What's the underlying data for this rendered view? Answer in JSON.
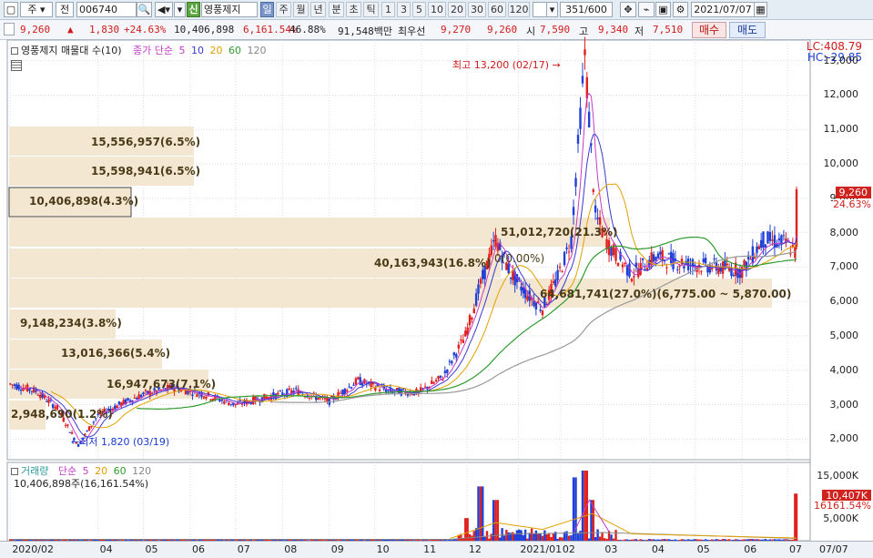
{
  "toolbar": {
    "market": "주",
    "period_mode": "전",
    "code": "006740",
    "name_badge": "신",
    "stock_name": "영풍제지",
    "interval_active": "일",
    "intervals": [
      "주",
      "월",
      "년",
      "분",
      "초",
      "틱"
    ],
    "minutes": [
      "1",
      "3",
      "5",
      "10",
      "20",
      "30",
      "60",
      "120"
    ],
    "count": "351/600",
    "date": "2021/07/07"
  },
  "pricebar": {
    "price": "9,260",
    "change": "1,830",
    "change_rate": "+24.63%",
    "volume": "10,406,898",
    "volume_rate": "6,161.54%",
    "ratio": "46.88%",
    "amount": "91,548백만",
    "best_label": "최우선",
    "ask": "9,270",
    "bid": "9,260",
    "open_label": "시",
    "open": "7,590",
    "high_label": "고",
    "high": "9,340",
    "low_label": "저",
    "low": "7,510",
    "buy_label": "매수",
    "sell_label": "매도"
  },
  "price_panel": {
    "legend_title": "영풍제지 매물대 수(10)",
    "ma_label": "종가 단순",
    "ma_periods": [
      "5",
      "10",
      "20",
      "60",
      "120"
    ],
    "ma_colors": [
      "#c43cc7",
      "#3a3ad0",
      "#e0a000",
      "#2e9b2e",
      "#888888"
    ],
    "lc": "LC:408.79",
    "hc": "HC:-29.85",
    "y_ticks": [
      "13,000",
      "12,000",
      "11,000",
      "10,000",
      "9,000",
      "8,000",
      "7,000",
      "6,000",
      "5,000",
      "4,000",
      "3,000",
      "2,000"
    ],
    "current_tag": "9,260",
    "current_rate": "24.63%",
    "high_annotation": "최고 13,200 (02/17)",
    "low_annotation": "최저 1,820 (03/19)"
  },
  "volume_profile": [
    {
      "text": "15,556,957(6.5%)"
    },
    {
      "text": "15,598,941(6.5%)"
    },
    {
      "text": "10,406,898(4.3%)"
    },
    {
      "text": "51,012,720(21.3%)"
    },
    {
      "text": "40,163,943(16.8%)"
    },
    {
      "text": "0(0.00%)"
    },
    {
      "text": "64,681,741(27.0%)(6,775.00 ~ 5,870.00)"
    },
    {
      "text": "9,148,234(3.8%)"
    },
    {
      "text": "13,016,366(5.4%)"
    },
    {
      "text": "16,947,673(7.1%)"
    },
    {
      "text": "2,948,690(1.2%)"
    }
  ],
  "volume_panel": {
    "legend_title": "거래량",
    "ma_label": "단순",
    "ma_periods": [
      "5",
      "20",
      "60",
      "120"
    ],
    "ma_colors": [
      "#c43cc7",
      "#e0a000",
      "#2e9b2e",
      "#888888"
    ],
    "last_volume": "10,406,898주(16,161.54%)",
    "y_ticks": [
      "15,000K",
      "5,000K"
    ],
    "current_tag": "10,407K",
    "current_rate": "16161.54%"
  },
  "x_axis": {
    "labels": [
      "2020/02",
      "04",
      "05",
      "06",
      "07",
      "08",
      "09",
      "10",
      "11",
      "12",
      "2021/01",
      "02",
      "03",
      "04",
      "05",
      "06",
      "07"
    ],
    "right_label": "07/07"
  },
  "chart_data": {
    "type": "candlestick",
    "title": "영풍제지 매물대 수(10)",
    "y_unit": "KRW",
    "ylim": [
      1400,
      13600
    ],
    "price_path": [
      [
        "2020-02-03",
        3600
      ],
      [
        "2020-02-20",
        3400
      ],
      [
        "2020-03-05",
        2900
      ],
      [
        "2020-03-19",
        1820
      ],
      [
        "2020-04-01",
        2700
      ],
      [
        "2020-04-15",
        3000
      ],
      [
        "2020-05-01",
        3300
      ],
      [
        "2020-05-20",
        3500
      ],
      [
        "2020-06-10",
        3300
      ],
      [
        "2020-07-01",
        3000
      ],
      [
        "2020-07-20",
        3200
      ],
      [
        "2020-08-10",
        3400
      ],
      [
        "2020-09-01",
        3100
      ],
      [
        "2020-09-20",
        3700
      ],
      [
        "2020-10-10",
        3400
      ],
      [
        "2020-10-30",
        3350
      ],
      [
        "2020-11-15",
        3800
      ],
      [
        "2020-11-30",
        5000
      ],
      [
        "2020-12-10",
        6500
      ],
      [
        "2020-12-20",
        7800
      ],
      [
        "2020-12-30",
        6800
      ],
      [
        "2021-01-10",
        6200
      ],
      [
        "2021-01-20",
        5800
      ],
      [
        "2021-01-30",
        6700
      ],
      [
        "2021-02-08",
        7800
      ],
      [
        "2021-02-17",
        13200
      ],
      [
        "2021-02-24",
        8500
      ],
      [
        "2021-03-05",
        7600
      ],
      [
        "2021-03-20",
        6800
      ],
      [
        "2021-04-05",
        7300
      ],
      [
        "2021-04-25",
        7100
      ],
      [
        "2021-05-15",
        7000
      ],
      [
        "2021-06-01",
        6900
      ],
      [
        "2021-06-15",
        7800
      ],
      [
        "2021-06-30",
        7700
      ],
      [
        "2021-07-06",
        7430
      ],
      [
        "2021-07-07",
        9260
      ]
    ],
    "volume_spikes": [
      [
        "2020-12-01",
        5000
      ],
      [
        "2020-12-10",
        12000
      ],
      [
        "2020-12-20",
        9000
      ],
      [
        "2021-02-10",
        14000
      ],
      [
        "2021-02-17",
        15500
      ],
      [
        "2021-02-22",
        9000
      ],
      [
        "2021-07-07",
        10407
      ]
    ]
  }
}
